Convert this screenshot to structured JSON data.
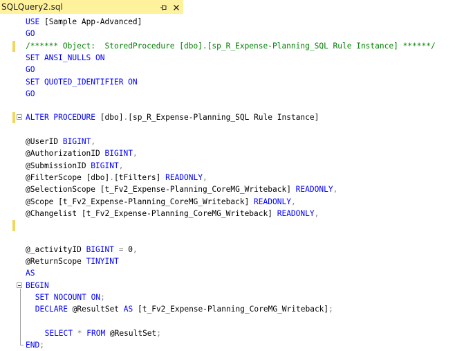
{
  "tab": {
    "title": "SQLQuery2.sql",
    "pin_icon": "pin-icon",
    "close_icon": "close-icon"
  },
  "colors": {
    "keyword": "#0000ff",
    "comment": "#008000",
    "operator": "#808080",
    "tab": "#fff29d",
    "marker": "#f0d760"
  },
  "lines": [
    {
      "marker": false,
      "outline": "none",
      "indent": 0,
      "tokens": [
        {
          "t": "USE ",
          "c": "kw"
        },
        {
          "t": "[Sample App-Advanced]",
          "c": "id"
        }
      ]
    },
    {
      "marker": false,
      "outline": "none",
      "indent": 0,
      "tokens": [
        {
          "t": "GO",
          "c": "kw"
        }
      ]
    },
    {
      "marker": true,
      "outline": "none",
      "indent": 0,
      "tokens": [
        {
          "t": "/****** Object:  StoredProcedure [dbo].[sp_R_Expense-Planning_SQL Rule Instance] ******/",
          "c": "cm"
        }
      ]
    },
    {
      "marker": false,
      "outline": "none",
      "indent": 0,
      "tokens": [
        {
          "t": "SET ANSI_NULLS ON",
          "c": "kw"
        }
      ]
    },
    {
      "marker": false,
      "outline": "none",
      "indent": 0,
      "tokens": [
        {
          "t": "GO",
          "c": "kw"
        }
      ]
    },
    {
      "marker": false,
      "outline": "none",
      "indent": 0,
      "tokens": [
        {
          "t": "SET QUOTED_IDENTIFIER ON",
          "c": "kw"
        }
      ]
    },
    {
      "marker": false,
      "outline": "none",
      "indent": 0,
      "tokens": [
        {
          "t": "GO",
          "c": "kw"
        }
      ]
    },
    {
      "marker": false,
      "outline": "none",
      "indent": 0,
      "tokens": []
    },
    {
      "marker": true,
      "outline": "box",
      "indent": 0,
      "tokens": [
        {
          "t": "ALTER PROCEDURE ",
          "c": "kw"
        },
        {
          "t": "[dbo]",
          "c": "id"
        },
        {
          "t": ".",
          "c": "gr"
        },
        {
          "t": "[sp_R_Expense-Planning_SQL Rule Instance]",
          "c": "id"
        }
      ]
    },
    {
      "marker": false,
      "outline": "none",
      "indent": 0,
      "tokens": []
    },
    {
      "marker": false,
      "outline": "none",
      "indent": 0,
      "tokens": [
        {
          "t": "@UserID ",
          "c": "id"
        },
        {
          "t": "BIGINT",
          "c": "kw"
        },
        {
          "t": ",",
          "c": "gr"
        }
      ]
    },
    {
      "marker": false,
      "outline": "none",
      "indent": 0,
      "tokens": [
        {
          "t": "@AuthorizationID ",
          "c": "id"
        },
        {
          "t": "BIGINT",
          "c": "kw"
        },
        {
          "t": ",",
          "c": "gr"
        }
      ]
    },
    {
      "marker": false,
      "outline": "none",
      "indent": 0,
      "tokens": [
        {
          "t": "@SubmissionID ",
          "c": "id"
        },
        {
          "t": "BIGINT",
          "c": "kw"
        },
        {
          "t": ",",
          "c": "gr"
        }
      ]
    },
    {
      "marker": false,
      "outline": "none",
      "indent": 0,
      "tokens": [
        {
          "t": "@FilterScope ",
          "c": "id"
        },
        {
          "t": "[dbo]",
          "c": "id"
        },
        {
          "t": ".",
          "c": "gr"
        },
        {
          "t": "[tFilters] ",
          "c": "id"
        },
        {
          "t": "READONLY",
          "c": "kw"
        },
        {
          "t": ",",
          "c": "gr"
        }
      ]
    },
    {
      "marker": false,
      "outline": "none",
      "indent": 0,
      "tokens": [
        {
          "t": "@SelectionScope ",
          "c": "id"
        },
        {
          "t": "[t_Fv2_Expense-Planning_CoreMG_Writeback] ",
          "c": "id"
        },
        {
          "t": "READONLY",
          "c": "kw"
        },
        {
          "t": ",",
          "c": "gr"
        }
      ]
    },
    {
      "marker": false,
      "outline": "none",
      "indent": 0,
      "tokens": [
        {
          "t": "@Scope ",
          "c": "id"
        },
        {
          "t": "[t_Fv2_Expense-Planning_CoreMG_Writeback] ",
          "c": "id"
        },
        {
          "t": "READONLY",
          "c": "kw"
        },
        {
          "t": ",",
          "c": "gr"
        }
      ]
    },
    {
      "marker": false,
      "outline": "none",
      "indent": 0,
      "tokens": [
        {
          "t": "@Changelist ",
          "c": "id"
        },
        {
          "t": "[t_Fv2_Expense-Planning_CoreMG_Writeback] ",
          "c": "id"
        },
        {
          "t": "READONLY",
          "c": "kw"
        },
        {
          "t": ",",
          "c": "gr"
        }
      ]
    },
    {
      "marker": true,
      "outline": "none",
      "indent": 0,
      "tokens": []
    },
    {
      "marker": false,
      "outline": "none",
      "indent": 0,
      "tokens": []
    },
    {
      "marker": false,
      "outline": "none",
      "indent": 0,
      "tokens": [
        {
          "t": "@_activityID ",
          "c": "id"
        },
        {
          "t": "BIGINT ",
          "c": "kw"
        },
        {
          "t": "= ",
          "c": "gr"
        },
        {
          "t": "0",
          "c": "id"
        },
        {
          "t": ",",
          "c": "gr"
        }
      ]
    },
    {
      "marker": false,
      "outline": "none",
      "indent": 0,
      "tokens": [
        {
          "t": "@ReturnScope ",
          "c": "id"
        },
        {
          "t": "TINYINT",
          "c": "kw"
        }
      ]
    },
    {
      "marker": false,
      "outline": "none",
      "indent": 0,
      "tokens": [
        {
          "t": "AS",
          "c": "kw"
        }
      ]
    },
    {
      "marker": false,
      "outline": "box",
      "indent": 0,
      "tokens": [
        {
          "t": "BEGIN",
          "c": "kw"
        }
      ]
    },
    {
      "marker": false,
      "outline": "none",
      "indent": 2,
      "tokens": [
        {
          "t": "SET NOCOUNT ON",
          "c": "kw"
        },
        {
          "t": ";",
          "c": "gr"
        }
      ]
    },
    {
      "marker": false,
      "outline": "none",
      "indent": 2,
      "tokens": [
        {
          "t": "DECLARE ",
          "c": "kw"
        },
        {
          "t": "@ResultSet ",
          "c": "id"
        },
        {
          "t": "AS ",
          "c": "kw"
        },
        {
          "t": "[t_Fv2_Expense-Planning_CoreMG_Writeback]",
          "c": "id"
        },
        {
          "t": ";",
          "c": "gr"
        }
      ]
    },
    {
      "marker": false,
      "outline": "none",
      "indent": 0,
      "tokens": []
    },
    {
      "marker": false,
      "outline": "none",
      "indent": 4,
      "tokens": [
        {
          "t": "SELECT ",
          "c": "kw"
        },
        {
          "t": "* ",
          "c": "gr"
        },
        {
          "t": "FROM ",
          "c": "kw"
        },
        {
          "t": "@ResultSet",
          "c": "id"
        },
        {
          "t": ";",
          "c": "gr"
        }
      ]
    },
    {
      "marker": false,
      "outline": "end",
      "indent": 0,
      "tokens": [
        {
          "t": "END",
          "c": "kw"
        },
        {
          "t": ";",
          "c": "gr"
        }
      ]
    }
  ]
}
